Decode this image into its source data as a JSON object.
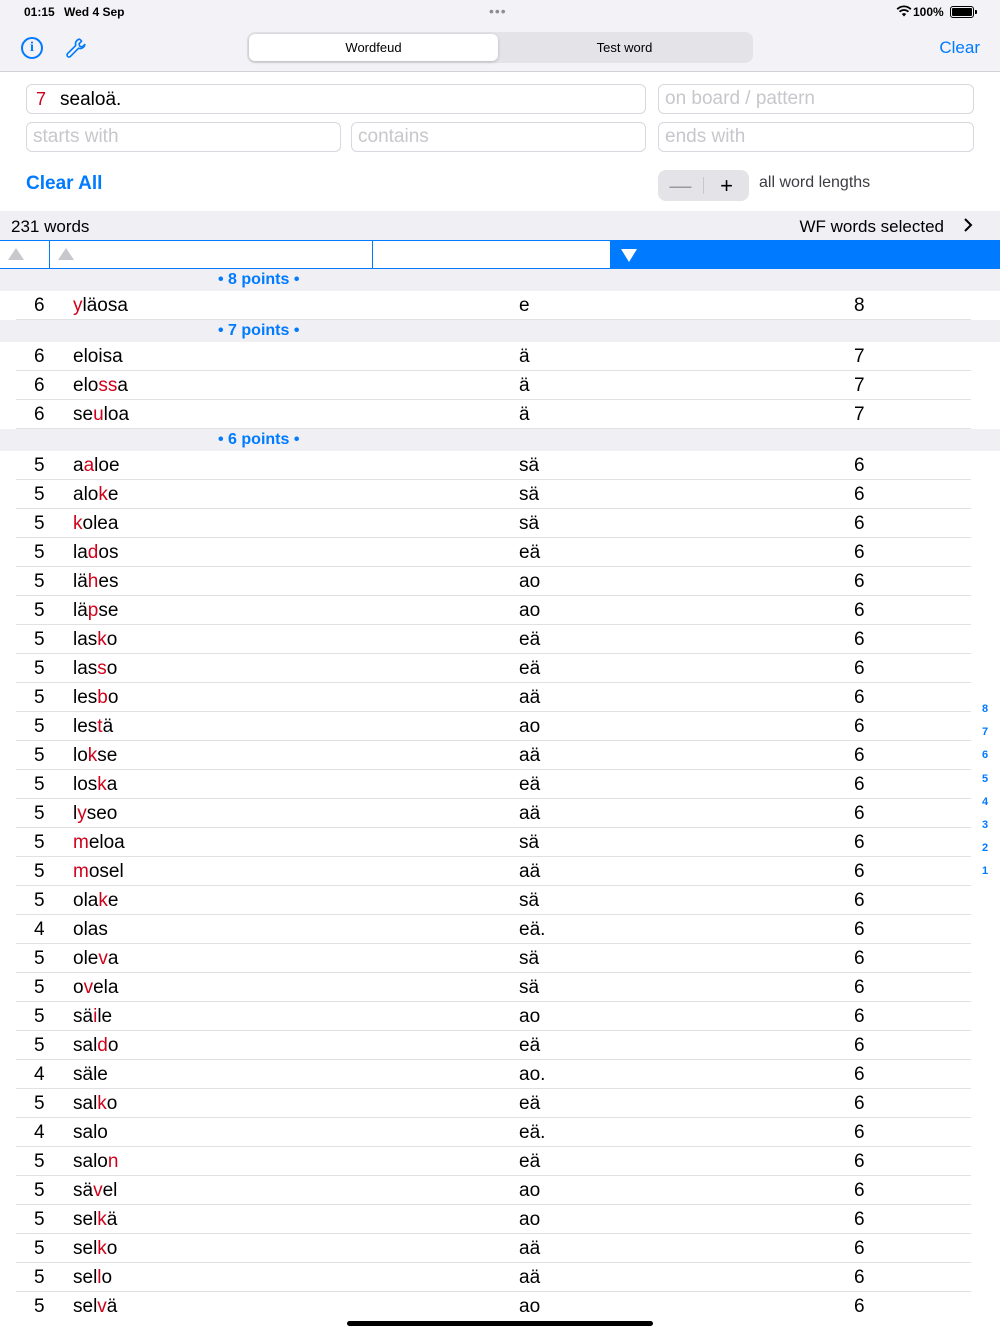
{
  "status_bar": {
    "time": "01:15",
    "date": "Wed 4 Sep",
    "dots": "•••",
    "battery": "100%"
  },
  "nav": {
    "info_icon": "info-icon",
    "settings_icon": "wrench-icon",
    "segments": [
      "Wordfeud",
      "Test word"
    ],
    "selected_segment": "Wordfeud",
    "clear_label": "Clear"
  },
  "filters": {
    "letters_count": "7",
    "letters_value": "sealoä.",
    "pattern_placeholder": "on board / pattern",
    "starts_with_placeholder": "starts with",
    "contains_placeholder": "contains",
    "ends_with_placeholder": "ends with"
  },
  "actions": {
    "clear_all_label": "Clear All",
    "stepper_minus": "—",
    "stepper_plus": "+",
    "lengths_label": "all word lengths"
  },
  "summary": {
    "word_count": "231 words",
    "wf_selected": "WF words selected"
  },
  "sections": [
    {
      "header": "• 8 points •",
      "rows": [
        {
          "len": "6",
          "pre": "",
          "hl": "y",
          "post": "läosa",
          "rest": "e",
          "pts": "8"
        }
      ]
    },
    {
      "header": "• 7 points •",
      "rows": [
        {
          "len": "6",
          "pre": "eloisa",
          "hl": "",
          "post": "",
          "rest": "ä",
          "pts": "7"
        },
        {
          "len": "6",
          "pre": "elo",
          "hl": "ss",
          "post": "a",
          "rest": "ä",
          "pts": "7"
        },
        {
          "len": "6",
          "pre": "se",
          "hl": "u",
          "post": "loa",
          "rest": "ä",
          "pts": "7"
        }
      ]
    },
    {
      "header": "• 6 points •",
      "rows": [
        {
          "len": "5",
          "pre": "a",
          "hl": "a",
          "post": "loe",
          "rest": "sä",
          "pts": "6"
        },
        {
          "len": "5",
          "pre": "alo",
          "hl": "k",
          "post": "e",
          "rest": "sä",
          "pts": "6"
        },
        {
          "len": "5",
          "pre": "",
          "hl": "k",
          "post": "olea",
          "rest": "sä",
          "pts": "6"
        },
        {
          "len": "5",
          "pre": "la",
          "hl": "d",
          "post": "os",
          "rest": "eä",
          "pts": "6"
        },
        {
          "len": "5",
          "pre": "lä",
          "hl": "h",
          "post": "es",
          "rest": "ao",
          "pts": "6"
        },
        {
          "len": "5",
          "pre": "lä",
          "hl": "p",
          "post": "se",
          "rest": "ao",
          "pts": "6"
        },
        {
          "len": "5",
          "pre": "las",
          "hl": "k",
          "post": "o",
          "rest": "eä",
          "pts": "6"
        },
        {
          "len": "5",
          "pre": "las",
          "hl": "s",
          "post": "o",
          "rest": "eä",
          "pts": "6"
        },
        {
          "len": "5",
          "pre": "les",
          "hl": "b",
          "post": "o",
          "rest": "aä",
          "pts": "6"
        },
        {
          "len": "5",
          "pre": "les",
          "hl": "t",
          "post": "ä",
          "rest": "ao",
          "pts": "6"
        },
        {
          "len": "5",
          "pre": "lo",
          "hl": "k",
          "post": "se",
          "rest": "aä",
          "pts": "6"
        },
        {
          "len": "5",
          "pre": "los",
          "hl": "k",
          "post": "a",
          "rest": "eä",
          "pts": "6"
        },
        {
          "len": "5",
          "pre": "l",
          "hl": "y",
          "post": "seo",
          "rest": "aä",
          "pts": "6"
        },
        {
          "len": "5",
          "pre": "",
          "hl": "m",
          "post": "eloa",
          "rest": "sä",
          "pts": "6"
        },
        {
          "len": "5",
          "pre": "",
          "hl": "m",
          "post": "osel",
          "rest": "aä",
          "pts": "6"
        },
        {
          "len": "5",
          "pre": "ola",
          "hl": "k",
          "post": "e",
          "rest": "sä",
          "pts": "6"
        },
        {
          "len": "4",
          "pre": "olas",
          "hl": "",
          "post": "",
          "rest": "eä.",
          "pts": "6"
        },
        {
          "len": "5",
          "pre": "ole",
          "hl": "v",
          "post": "a",
          "rest": "sä",
          "pts": "6"
        },
        {
          "len": "5",
          "pre": "o",
          "hl": "v",
          "post": "ela",
          "rest": "sä",
          "pts": "6"
        },
        {
          "len": "5",
          "pre": "sä",
          "hl": "i",
          "post": "le",
          "rest": "ao",
          "pts": "6"
        },
        {
          "len": "5",
          "pre": "sal",
          "hl": "d",
          "post": "o",
          "rest": "eä",
          "pts": "6"
        },
        {
          "len": "4",
          "pre": "säle",
          "hl": "",
          "post": "",
          "rest": "ao.",
          "pts": "6"
        },
        {
          "len": "5",
          "pre": "sal",
          "hl": "k",
          "post": "o",
          "rest": "eä",
          "pts": "6"
        },
        {
          "len": "4",
          "pre": "salo",
          "hl": "",
          "post": "",
          "rest": "eä.",
          "pts": "6"
        },
        {
          "len": "5",
          "pre": "salo",
          "hl": "n",
          "post": "",
          "rest": "eä",
          "pts": "6"
        },
        {
          "len": "5",
          "pre": "sä",
          "hl": "v",
          "post": "el",
          "rest": "ao",
          "pts": "6"
        },
        {
          "len": "5",
          "pre": "sel",
          "hl": "k",
          "post": "ä",
          "rest": "ao",
          "pts": "6"
        },
        {
          "len": "5",
          "pre": "sel",
          "hl": "k",
          "post": "o",
          "rest": "aä",
          "pts": "6"
        },
        {
          "len": "5",
          "pre": "sel",
          "hl": "l",
          "post": "o",
          "rest": "aä",
          "pts": "6"
        },
        {
          "len": "5",
          "pre": "sel",
          "hl": "v",
          "post": "ä",
          "rest": "ao",
          "pts": "6"
        }
      ]
    }
  ],
  "index": [
    "8",
    "7",
    "6",
    "5",
    "4",
    "3",
    "2",
    "1"
  ],
  "colors": {
    "accent": "#007aff",
    "highlight": "#d0021b"
  }
}
